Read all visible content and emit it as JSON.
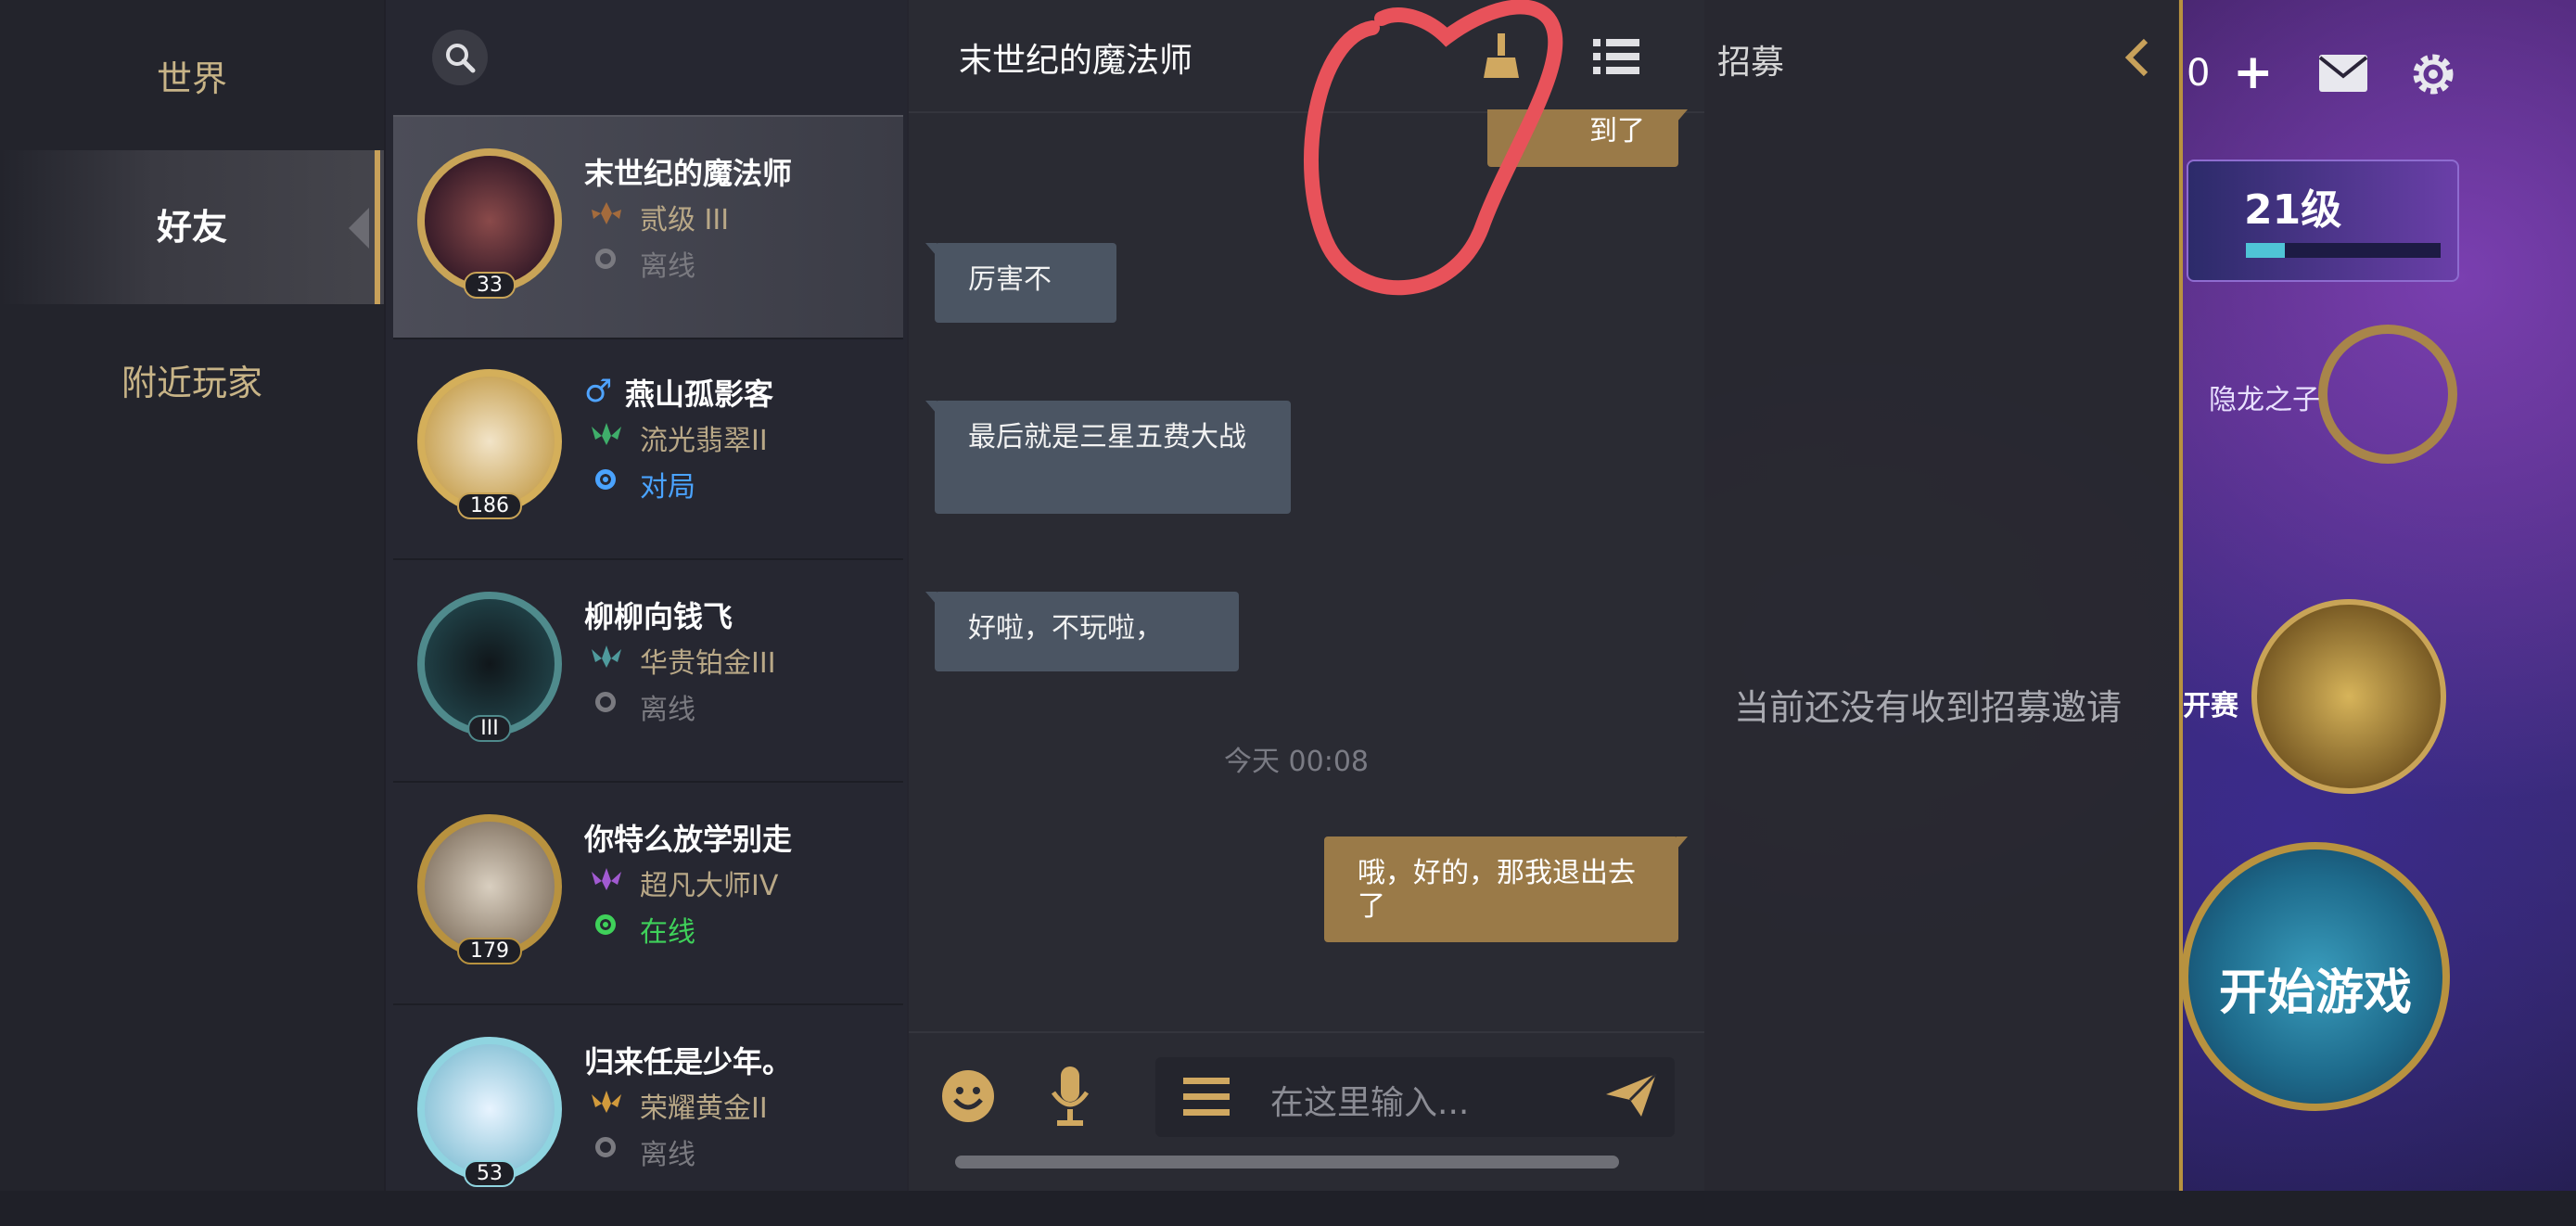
{
  "categories": [
    {
      "label": "世界",
      "active": false
    },
    {
      "label": "好友",
      "active": true
    },
    {
      "label": "附近玩家",
      "active": false
    }
  ],
  "friends": [
    {
      "name": "末世纪的魔法师",
      "rank": "贰级 III",
      "status": "离线",
      "level": "33",
      "selected": true,
      "status_color": "#7a7a80",
      "rank_color": "#b9a887",
      "avatar_color": "#5b2a2a"
    },
    {
      "name": "燕山孤影客",
      "rank": "流光翡翠II",
      "status": "对局",
      "level": "186",
      "selected": false,
      "status_color": "#4aa3ff",
      "rank_color": "#b9a887",
      "avatar_color": "#c9a457",
      "gender": "♂"
    },
    {
      "name": "柳柳向钱飞",
      "rank": "华贵铂金III",
      "status": "离线",
      "level": "III",
      "selected": false,
      "status_color": "#7a7a80",
      "rank_color": "#b9a887",
      "avatar_color": "#183a3f"
    },
    {
      "name": "你特么放学别走",
      "rank": "超凡大师IV",
      "status": "在线",
      "level": "179",
      "selected": false,
      "status_color": "#3fd15a",
      "rank_color": "#b9a887",
      "avatar_color": "#8a7b6a"
    },
    {
      "name": "归来任是少年。",
      "rank": "荣耀黄金II",
      "status": "离线",
      "level": "53",
      "selected": false,
      "status_color": "#7a7a80",
      "rank_color": "#b9a887",
      "avatar_color": "#9fd0e0"
    }
  ],
  "chat": {
    "title": "末世纪的魔法师",
    "messages": [
      {
        "dir": "out",
        "text": "到了"
      },
      {
        "dir": "in",
        "text": "厉害不"
      },
      {
        "dir": "in",
        "text": "最后就是三星五费大战"
      },
      {
        "dir": "in",
        "text": "好啦，不玩啦，"
      },
      {
        "dir": "out",
        "text": "哦，好的，那我退出去了"
      }
    ],
    "timestamp": "今天 00:08",
    "input_placeholder": "在这里输入..."
  },
  "recruit": {
    "title": "招募",
    "empty_text": "当前还没有收到招募邀请"
  },
  "hud": {
    "currency": "0",
    "level_label": "21级",
    "pass_label": "隐龙之子",
    "start_button": "开始游戏",
    "tournament_label": "开赛"
  },
  "colors": {
    "gold": "#c9a457",
    "out_bubble": "#9a7a48",
    "in_bubble": "#4b5563",
    "annotation": "#e8525a"
  }
}
